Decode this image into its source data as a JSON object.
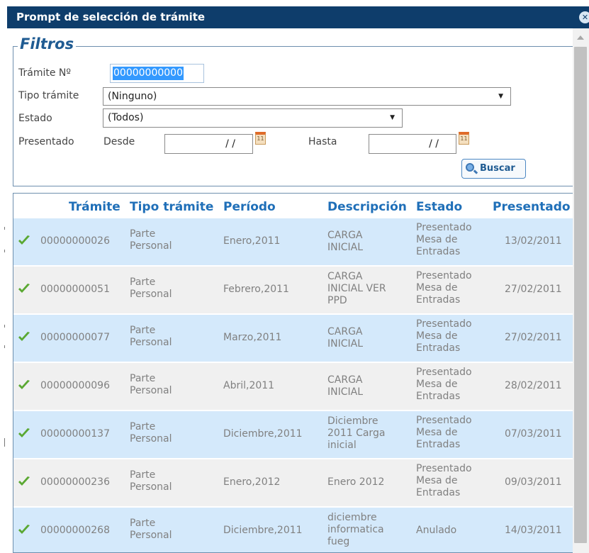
{
  "dialog": {
    "title": "Prompt de selección de trámite",
    "close_icon": "close-icon"
  },
  "filters": {
    "legend": "Filtros",
    "tramite_label": "Trámite Nº",
    "tramite_value": "00000000000",
    "tipo_label": "Tipo trámite",
    "tipo_value": "(Ninguno)",
    "estado_label": "Estado",
    "estado_value": "(Todos)",
    "presentado_label": "Presentado",
    "desde_label": "Desde",
    "desde_value": "/ /",
    "hasta_label": "Hasta",
    "hasta_value": "/ /",
    "calendar_glyph": "11",
    "buscar_label": "Buscar"
  },
  "grid": {
    "columns": [
      "Trámite",
      "Tipo trámite",
      "Período",
      "Descripción",
      "Estado",
      "Presentado"
    ],
    "rows": [
      {
        "tramite": "00000000026",
        "tipo": "Parte\nPersonal",
        "periodo": "Enero,2011",
        "descripcion": "CARGA\nINICIAL",
        "estado": "Presentado\nMesa de\nEntradas",
        "presentado": "13/02/2011"
      },
      {
        "tramite": "00000000051",
        "tipo": "Parte\nPersonal",
        "periodo": "Febrero,2011",
        "descripcion": "CARGA\nINICIAL VER\nPPD",
        "estado": "Presentado\nMesa de\nEntradas",
        "presentado": "27/02/2011"
      },
      {
        "tramite": "00000000077",
        "tipo": "Parte\nPersonal",
        "periodo": "Marzo,2011",
        "descripcion": "CARGA\nINICIAL",
        "estado": "Presentado\nMesa de\nEntradas",
        "presentado": "27/02/2011"
      },
      {
        "tramite": "00000000096",
        "tipo": "Parte\nPersonal",
        "periodo": "Abril,2011",
        "descripcion": "CARGA\nINICIAL",
        "estado": "Presentado\nMesa de\nEntradas",
        "presentado": "28/02/2011"
      },
      {
        "tramite": "00000000137",
        "tipo": "Parte\nPersonal",
        "periodo": "Diciembre,2011",
        "descripcion": "Diciembre\n2011 Carga\ninicial",
        "estado": "Presentado\nMesa de\nEntradas",
        "presentado": "07/03/2011"
      },
      {
        "tramite": "00000000236",
        "tipo": "Parte\nPersonal",
        "periodo": "Enero,2012",
        "descripcion": "Enero 2012",
        "estado": "Presentado\nMesa de\nEntradas",
        "presentado": "09/03/2011"
      },
      {
        "tramite": "00000000268",
        "tipo": "Parte\nPersonal",
        "periodo": "Diciembre,2011",
        "descripcion": "diciembre\ninformatica\nfueg",
        "estado": "Anulado",
        "presentado": "14/03/2011"
      }
    ]
  },
  "colors": {
    "title_bar": "#0e3d6b",
    "header_text": "#1f6fb8",
    "row_odd": "#d4e9fb",
    "row_even": "#f0f0f0",
    "check": "#5aa832"
  }
}
